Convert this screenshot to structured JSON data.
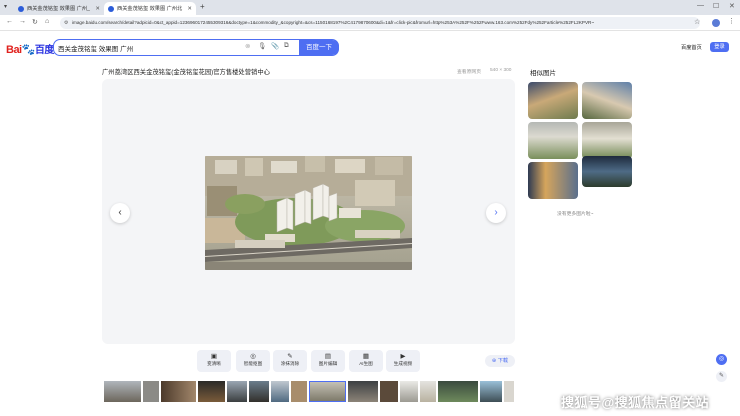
{
  "browser": {
    "tabs": [
      {
        "title": "西关金茂铭玺 效果图 广州_",
        "active": false
      },
      {
        "title": "西关金茂铭玺 效果图 广州北",
        "active": true
      }
    ],
    "new_tab": "+",
    "url": "image.baidu.com/search/detail?adpicid=0&ct_appid=1236960172455309316&doctype=1&commodity_&copyright=&cs=1150168197%2C4179870600&di=1&fr=click-pic&fromurl=http%253A%252F%252Fwww.163.com%252Fdy%252Farticle%252FL2KPVR~"
  },
  "header": {
    "logo_bai": "Bai",
    "logo_paw": "🐾",
    "logo_du": "百度",
    "search_value": "西关金茂铭玺 效果图 广州",
    "search_button": "百度一下",
    "home_link": "百度首页",
    "login_button": "登录"
  },
  "main": {
    "title": "广州荔湾区西关金茂铭玺(金茂铭玺花园)官方售楼处营销中心",
    "source_label": "查看原网页",
    "dimensions": "540 × 300"
  },
  "tools": [
    {
      "icon": "▣",
      "label": "变清晰"
    },
    {
      "icon": "◎",
      "label": "智能抠图"
    },
    {
      "icon": "✎",
      "label": "涂抹消除"
    },
    {
      "icon": "▤",
      "label": "图片编辑"
    },
    {
      "icon": "▦",
      "label": "AI生图"
    },
    {
      "icon": "▶",
      "label": "生成视频"
    }
  ],
  "download_label": "下载",
  "sidebar": {
    "related_title": "相似图片",
    "more_link": "没有更多图片啦~"
  },
  "watermark": "搜狐号@搜狐焦点留关站",
  "colors": {
    "brand_blue": "#4e6ef2",
    "baidu_red": "#e0231f"
  }
}
